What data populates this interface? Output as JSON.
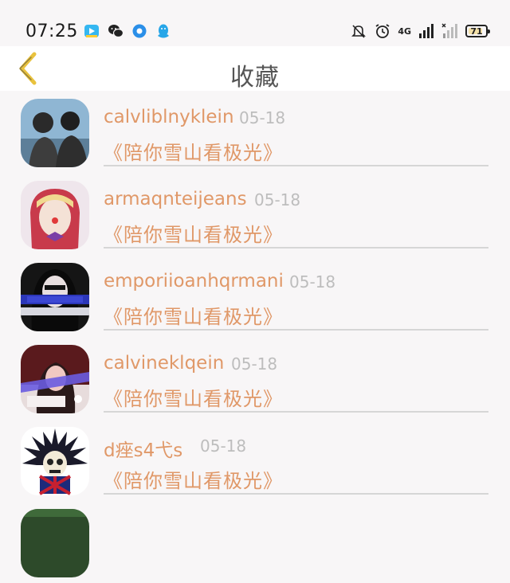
{
  "status_bar": {
    "time": "07:25",
    "app_icons": [
      "video-app-icon",
      "wechat-icon",
      "browser-icon",
      "qq-icon"
    ],
    "network_label": "4G",
    "battery_level": "71"
  },
  "nav": {
    "back_icon": "chevron-left-icon",
    "title": "收藏"
  },
  "favorites": [
    {
      "name": "calvliblnyklein",
      "date": "05-18",
      "title": "《陪你雪山看极光》"
    },
    {
      "name": "armaqnteijeans",
      "date": "05-18",
      "title": "《陪你雪山看极光》"
    },
    {
      "name": "emporiioanhqrmani",
      "date": "05-18",
      "title": "《陪你雪山看极光》"
    },
    {
      "name": "calvineklqein",
      "date": "05-18",
      "title": "《陪你雪山看极光》"
    },
    {
      "name": "d痤s4弋s",
      "date": "05-18",
      "title": "《陪你雪山看极光》"
    }
  ],
  "colors": {
    "accent": "#e09868",
    "date": "#bdbdbd",
    "back_icon": "#e9c23d",
    "title": "#555555"
  }
}
